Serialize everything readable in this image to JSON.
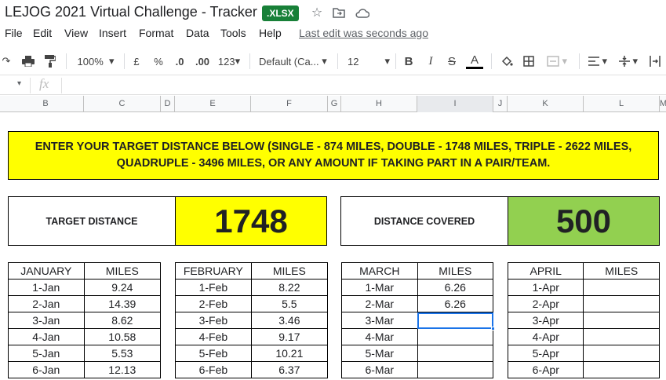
{
  "title": {
    "document_name": "LEJOG 2021 Virtual Challenge - Tracker",
    "badge": ".XLSX"
  },
  "menu": {
    "items": [
      "File",
      "Edit",
      "View",
      "Insert",
      "Format",
      "Data",
      "Tools",
      "Help"
    ],
    "last_edit": "Last edit was seconds ago"
  },
  "toolbar": {
    "zoom": "100%",
    "currency": "£",
    "percent": "%",
    "decrease_decimal": ".0",
    "increase_decimal": ".00",
    "more_formats": "123",
    "font": "Default (Ca...",
    "font_size": "12",
    "bold": "B",
    "italic": "I",
    "strike": "S",
    "text_color": "A"
  },
  "formula_bar": {
    "fx": "fx"
  },
  "columns": [
    "B",
    "C",
    "D",
    "E",
    "F",
    "G",
    "H",
    "I",
    "J",
    "K",
    "L",
    "M"
  ],
  "banner": {
    "line1": "ENTER YOUR TARGET DISTANCE BELOW (SINGLE - 874 MILES, DOUBLE - 1748 MILES, TRIPLE - 2622 MILES,",
    "line2": "QUADRUPLE - 3496 MILES, OR ANY AMOUNT IF TAKING PART IN A PAIR/TEAM."
  },
  "target": {
    "label": "TARGET DISTANCE",
    "value": "1748"
  },
  "covered": {
    "label": "DISTANCE COVERED",
    "value": "500"
  },
  "colors": {
    "banner": "#ffff00",
    "target_value_bg": "#ffff00",
    "covered_value_bg": "#92d050",
    "xlsx_badge": "#188038",
    "selection": "#1a73e8"
  },
  "months": [
    {
      "header": "JANUARY",
      "miles_header": "MILES",
      "rows": [
        {
          "date": "1-Jan",
          "miles": "9.24"
        },
        {
          "date": "2-Jan",
          "miles": "14.39"
        },
        {
          "date": "3-Jan",
          "miles": "8.62"
        },
        {
          "date": "4-Jan",
          "miles": "10.58"
        },
        {
          "date": "5-Jan",
          "miles": "5.53"
        },
        {
          "date": "6-Jan",
          "miles": "12.13"
        }
      ]
    },
    {
      "header": "FEBRUARY",
      "miles_header": "MILES",
      "rows": [
        {
          "date": "1-Feb",
          "miles": "8.22"
        },
        {
          "date": "2-Feb",
          "miles": "5.5"
        },
        {
          "date": "3-Feb",
          "miles": "3.46"
        },
        {
          "date": "4-Feb",
          "miles": "9.17"
        },
        {
          "date": "5-Feb",
          "miles": "10.21"
        },
        {
          "date": "6-Feb",
          "miles": "6.37"
        }
      ]
    },
    {
      "header": "MARCH",
      "miles_header": "MILES",
      "rows": [
        {
          "date": "1-Mar",
          "miles": "6.26"
        },
        {
          "date": "2-Mar",
          "miles": "6.26"
        },
        {
          "date": "3-Mar",
          "miles": ""
        },
        {
          "date": "4-Mar",
          "miles": ""
        },
        {
          "date": "5-Mar",
          "miles": ""
        },
        {
          "date": "6-Mar",
          "miles": ""
        }
      ]
    },
    {
      "header": "APRIL",
      "miles_header": "MILES",
      "rows": [
        {
          "date": "1-Apr",
          "miles": ""
        },
        {
          "date": "2-Apr",
          "miles": ""
        },
        {
          "date": "3-Apr",
          "miles": ""
        },
        {
          "date": "4-Apr",
          "miles": ""
        },
        {
          "date": "5-Apr",
          "miles": ""
        },
        {
          "date": "6-Apr",
          "miles": ""
        }
      ]
    }
  ]
}
